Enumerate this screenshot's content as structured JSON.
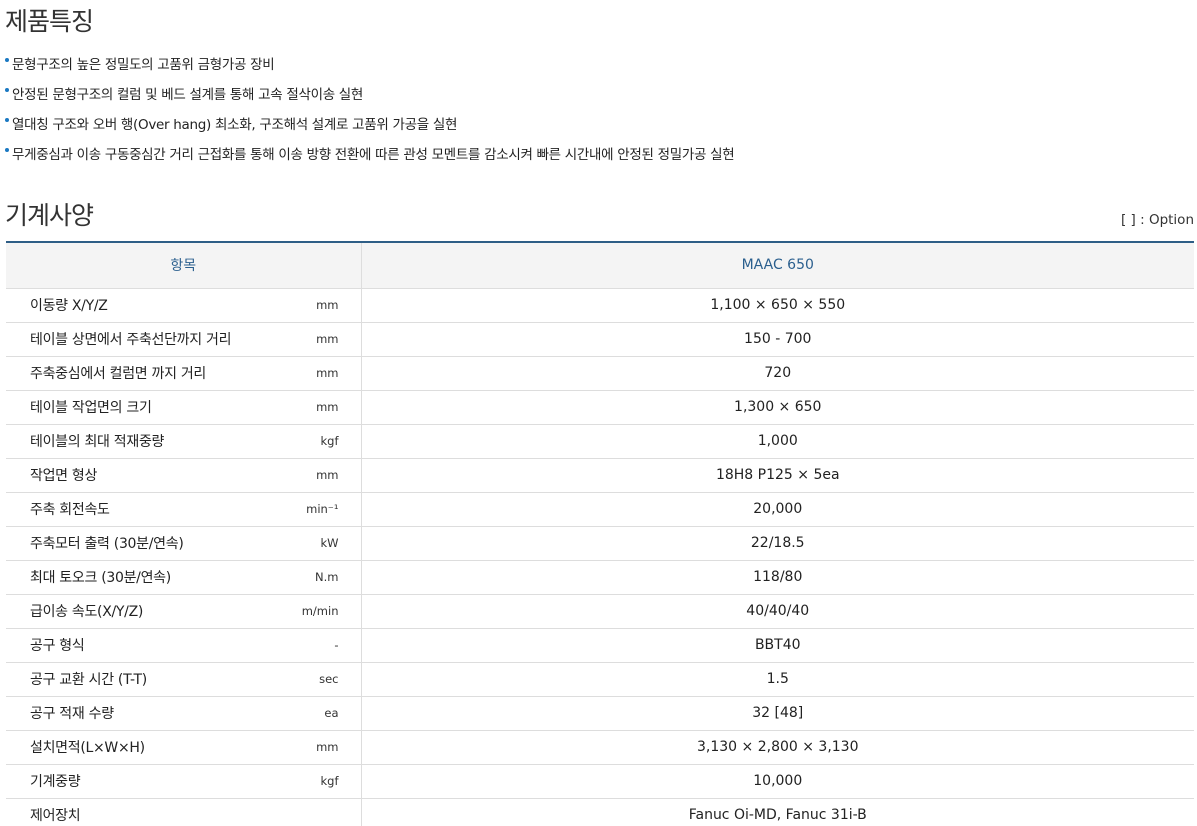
{
  "features": {
    "title": "제품특징",
    "items": [
      "문형구조의 높은 정밀도의 고품위 금형가공 장비",
      "안정된 문형구조의 컬럼 및 베드 설계를 통해 고속 절삭이송 실현",
      "열대칭 구조와 오버 행(Over hang) 최소화, 구조해석 설계로 고품위 가공을 실현",
      "무게중심과 이송 구동중심간 거리 근접화를 통해 이송 방향 전환에 따른 관성 모멘트를 감소시켜 빠른 시간내에 안정된 정밀가공 실현"
    ]
  },
  "specs": {
    "title": "기계사양",
    "option_note": "[ ] : Option",
    "header": {
      "item": "항목",
      "model": "MAAC 650"
    },
    "rows": [
      {
        "label": "이동량 X/Y/Z",
        "unit": "mm",
        "value": "1,100 × 650 × 550"
      },
      {
        "label": "테이블 상면에서 주축선단까지 거리",
        "unit": "mm",
        "value": "150 - 700"
      },
      {
        "label": "주축중심에서 컬럼면 까지 거리",
        "unit": "mm",
        "value": "720"
      },
      {
        "label": "테이블 작업면의 크기",
        "unit": "mm",
        "value": "1,300 × 650"
      },
      {
        "label": "테이블의 최대 적재중량",
        "unit": "kgf",
        "value": "1,000"
      },
      {
        "label": "작업면 형상",
        "unit": "mm",
        "value": "18H8 P125 × 5ea"
      },
      {
        "label": "주축 회전속도",
        "unit": "min⁻¹",
        "value": "20,000"
      },
      {
        "label": "주축모터 출력 (30분/연속)",
        "unit": "kW",
        "value": "22/18.5"
      },
      {
        "label": "최대 토오크 (30분/연속)",
        "unit": "N.m",
        "value": "118/80"
      },
      {
        "label": "급이송 속도(X/Y/Z)",
        "unit": "m/min",
        "value": "40/40/40"
      },
      {
        "label": "공구 형식",
        "unit": "-",
        "value": "BBT40"
      },
      {
        "label": "공구 교환 시간 (T-T)",
        "unit": "sec",
        "value": "1.5"
      },
      {
        "label": "공구 적재 수량",
        "unit": "ea",
        "value": "32 [48]"
      },
      {
        "label": "설치면적(L×W×H)",
        "unit": "mm",
        "value": "3,130 × 2,800 × 3,130"
      },
      {
        "label": "기계중량",
        "unit": "kgf",
        "value": "10,000"
      },
      {
        "label": "제어장치",
        "unit": "",
        "value": "Fanuc Oi-MD, Fanuc 31i-B"
      }
    ]
  },
  "colors": {
    "accent": "#2e5e86",
    "header_text": "#2b5f8e",
    "bullet": "#1a78c2"
  }
}
